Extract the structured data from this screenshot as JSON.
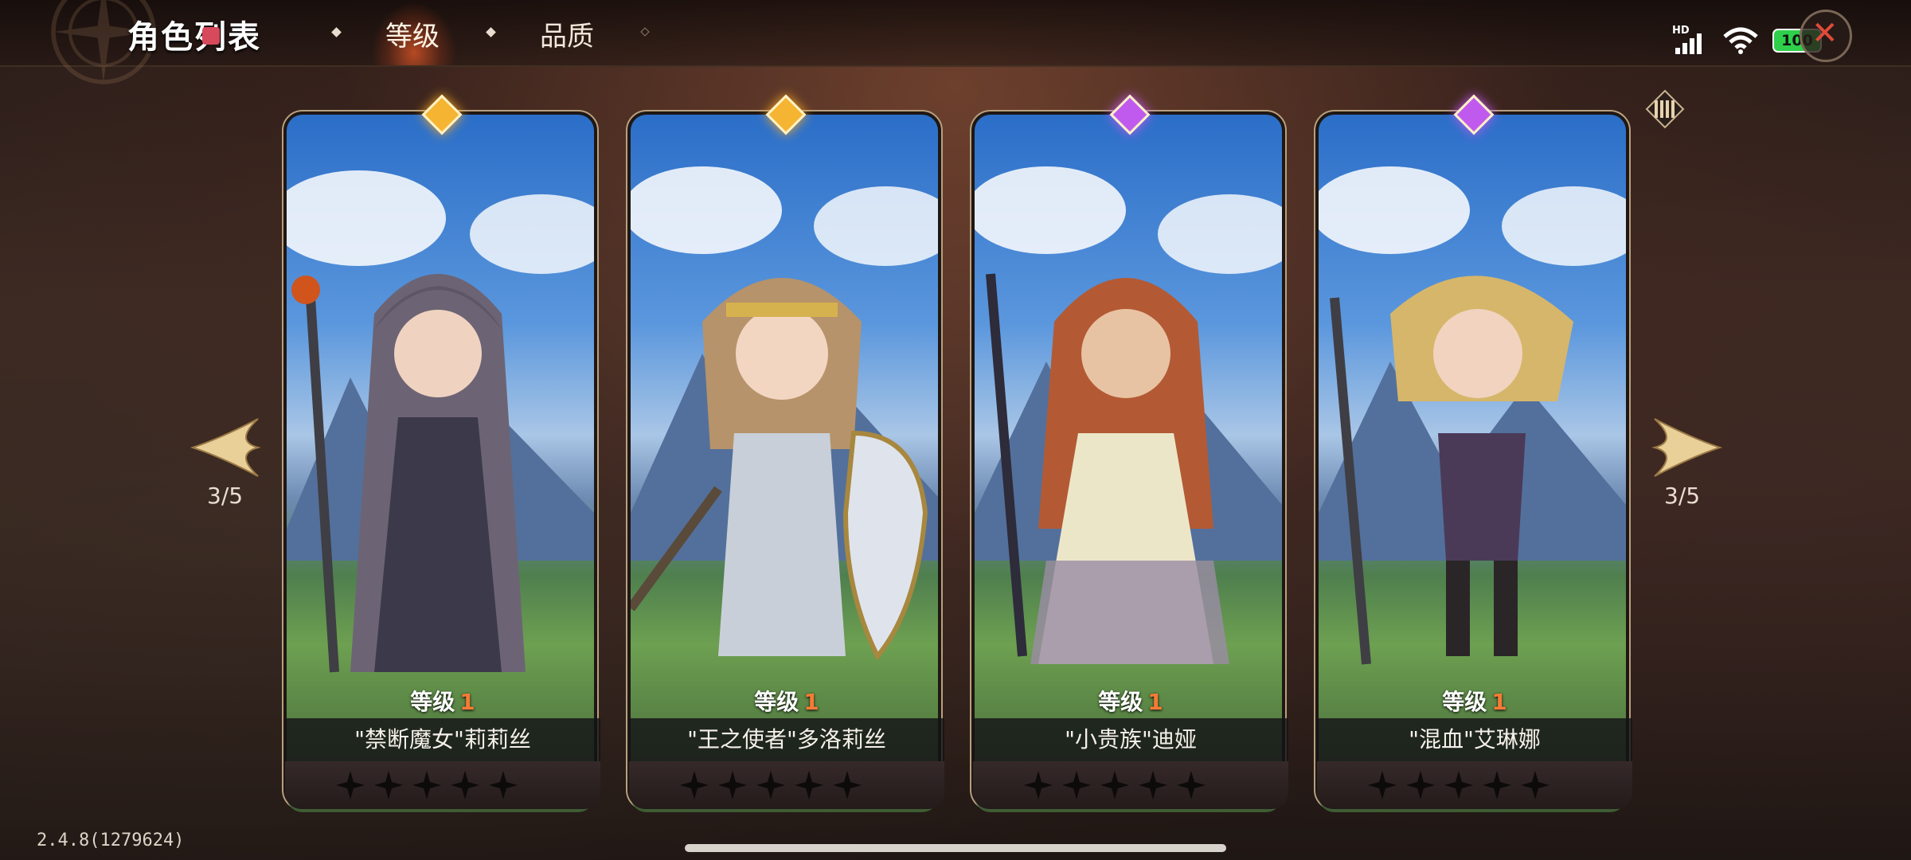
{
  "header": {
    "title": "角色列表",
    "tabs": [
      {
        "label": "等级",
        "active": true
      },
      {
        "label": "品质",
        "active": false
      }
    ]
  },
  "status_bar": {
    "network": "HD",
    "battery": "100"
  },
  "navigation": {
    "left_page": "3/5",
    "right_page": "3/5"
  },
  "cards": [
    {
      "level_label": "等级",
      "level": "1",
      "name": "\"禁断魔女\"莉莉丝",
      "rarity": "gold"
    },
    {
      "level_label": "等级",
      "level": "1",
      "name": "\"王之使者\"多洛莉丝",
      "rarity": "gold"
    },
    {
      "level_label": "等级",
      "level": "1",
      "name": "\"小贵族\"迪娅",
      "rarity": "purple"
    },
    {
      "level_label": "等级",
      "level": "1",
      "name": "\"混血\"艾琳娜",
      "rarity": "purple"
    }
  ],
  "version": "2.4.8(1279624)",
  "colors": {
    "gold_gem": "#f5b431",
    "purple_gem": "#c05aee",
    "level_number": "#f47b35"
  }
}
